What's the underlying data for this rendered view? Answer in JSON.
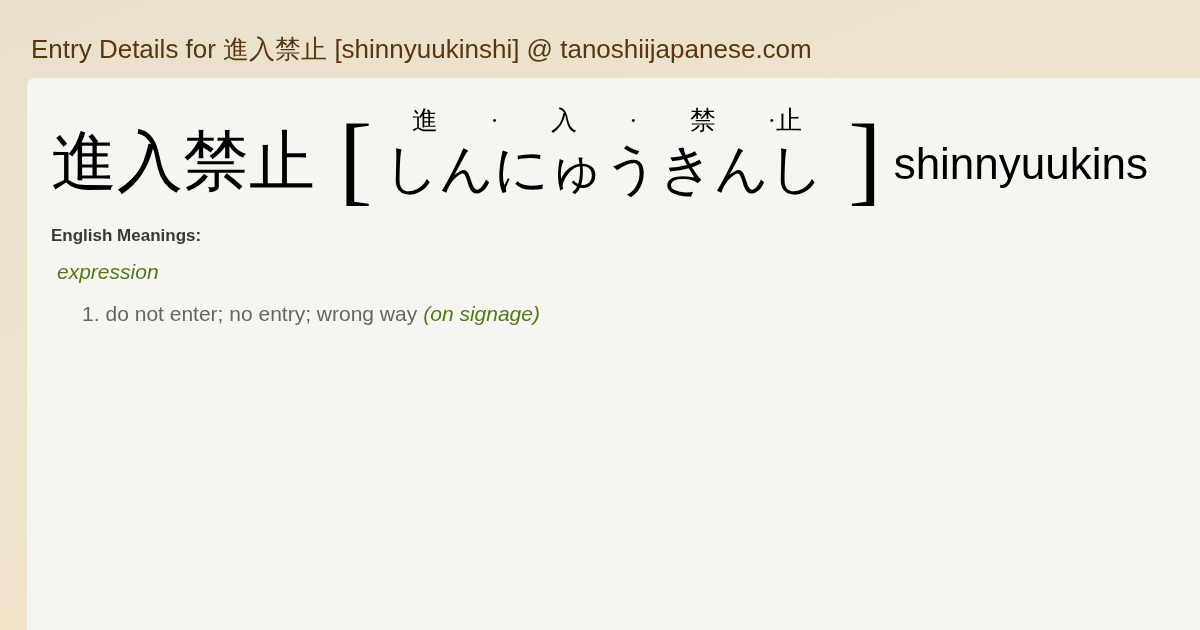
{
  "page_title": "Entry Details for 進入禁止 [shinnyuukinshi] @ tanoshiijapanese.com",
  "entry": {
    "word": "進入禁止",
    "bracket_open": "[",
    "bracket_close": "]",
    "furigana": [
      "進",
      "·",
      "入",
      "·",
      "禁",
      "·止"
    ],
    "reading": "しんにゅうきんし",
    "romaji": "shinnyuukins"
  },
  "meanings": {
    "heading": "English Meanings:",
    "part_of_speech": "expression",
    "senses": [
      {
        "number": "1.",
        "text": "do not enter; no entry; wrong way",
        "note": "(on signage)"
      }
    ]
  }
}
